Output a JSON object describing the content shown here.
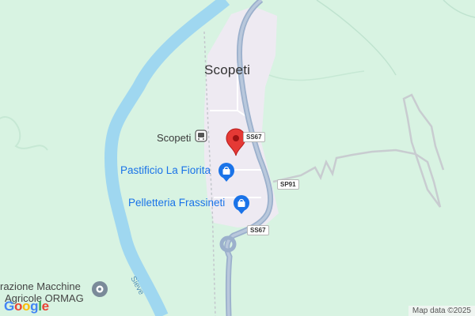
{
  "map": {
    "town_label": "Scopeti",
    "station_label": "Scopeti",
    "pois": [
      {
        "label": "Pastificio La Fiorita",
        "icon": "shopping-bag-icon"
      },
      {
        "label": "Pelletteria Frassineti",
        "icon": "shopping-bag-icon"
      }
    ],
    "company_label_line1": "razione Macchine",
    "company_label_line2": "Agricole ORMAG",
    "river_label": "Sieve",
    "road_shields": [
      "SS67",
      "SP91",
      "SS67"
    ],
    "attribution": "Map data ©2025",
    "logo": "Google",
    "colors": {
      "land": "#d8f3e2",
      "urban": "#eeeaf2",
      "river": "#9fd7f0",
      "road_primary": "#9bb0cc",
      "marker": "#e53935",
      "poi": "#1a73e8"
    }
  }
}
